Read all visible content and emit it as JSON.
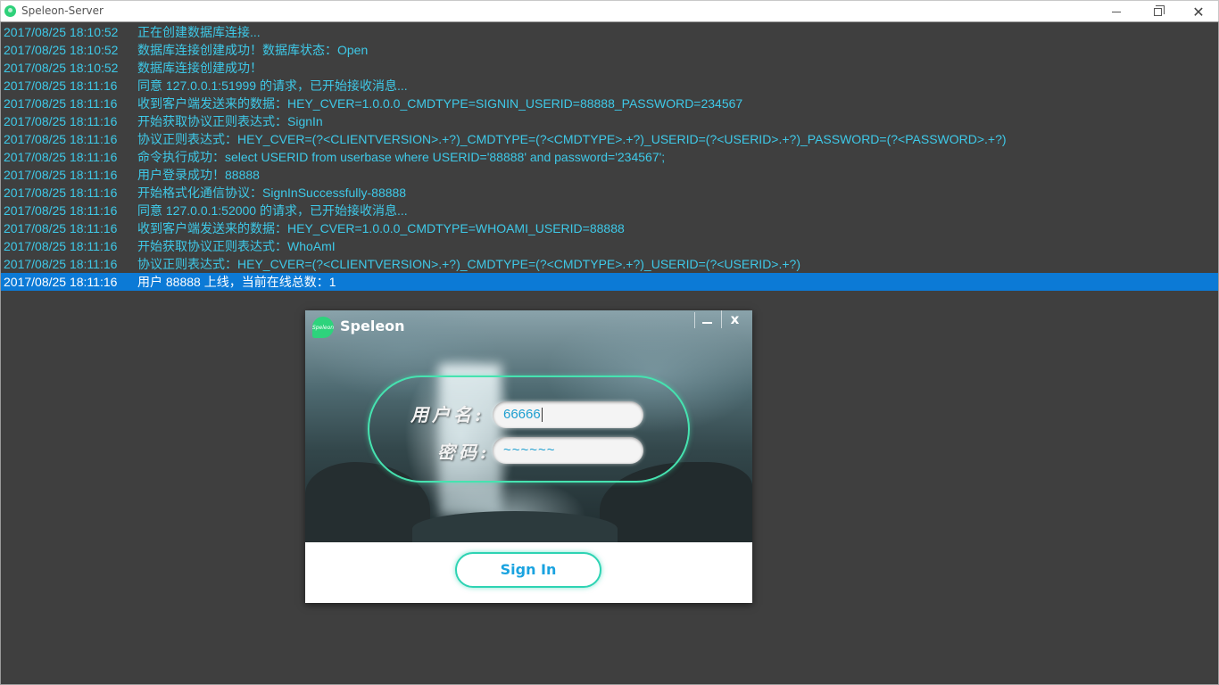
{
  "window": {
    "title": "Speleon-Server",
    "controls": {
      "minimize": "minimize-icon",
      "maximize": "restore-icon",
      "close": "close-icon"
    }
  },
  "log": [
    {
      "time": "2017/08/25 18:10:52",
      "message": "正在创建数据库连接..."
    },
    {
      "time": "2017/08/25 18:10:52",
      "message": "数据库连接创建成功！数据库状态：Open"
    },
    {
      "time": "2017/08/25 18:10:52",
      "message": "数据库连接创建成功！"
    },
    {
      "time": "2017/08/25 18:11:16",
      "message": "同意 127.0.0.1:51999 的请求，已开始接收消息..."
    },
    {
      "time": "2017/08/25 18:11:16",
      "message": "收到客户端发送来的数据：HEY_CVER=1.0.0.0_CMDTYPE=SIGNIN_USERID=88888_PASSWORD=234567"
    },
    {
      "time": "2017/08/25 18:11:16",
      "message": "开始获取协议正则表达式：SignIn"
    },
    {
      "time": "2017/08/25 18:11:16",
      "message": "协议正则表达式：HEY_CVER=(?<CLIENTVERSION>.+?)_CMDTYPE=(?<CMDTYPE>.+?)_USERID=(?<USERID>.+?)_PASSWORD=(?<PASSWORD>.+?)"
    },
    {
      "time": "2017/08/25 18:11:16",
      "message": "命令执行成功：select USERID from userbase where USERID='88888' and password='234567';"
    },
    {
      "time": "2017/08/25 18:11:16",
      "message": "用户登录成功！88888"
    },
    {
      "time": "2017/08/25 18:11:16",
      "message": "开始格式化通信协议：SignInSuccessfully-88888"
    },
    {
      "time": "2017/08/25 18:11:16",
      "message": "同意 127.0.0.1:52000 的请求，已开始接收消息..."
    },
    {
      "time": "2017/08/25 18:11:16",
      "message": "收到客户端发送来的数据：HEY_CVER=1.0.0.0_CMDTYPE=WHOAMI_USERID=88888"
    },
    {
      "time": "2017/08/25 18:11:16",
      "message": "开始获取协议正则表达式：WhoAmI"
    },
    {
      "time": "2017/08/25 18:11:16",
      "message": "协议正则表达式：HEY_CVER=(?<CLIENTVERSION>.+?)_CMDTYPE=(?<CMDTYPE>.+?)_USERID=(?<USERID>.+?)"
    },
    {
      "time": "2017/08/25 18:11:16",
      "message": "用户 88888 上线，当前在线总数：1",
      "selected": true
    }
  ],
  "login": {
    "brand": "Speleon",
    "logo_text": "Speleon",
    "username_label": "用户名:",
    "password_label": "密码:",
    "username_value": "66666",
    "password_value": "~~~~~~",
    "signin_label": "Sign In",
    "minimize_icon": "minimize-icon",
    "close_label": "x"
  },
  "colors": {
    "log_text": "#3ec9e8",
    "log_bg": "#3f3f3f",
    "selected_bg": "#0c7ad6",
    "accent": "#2ed3b3"
  }
}
